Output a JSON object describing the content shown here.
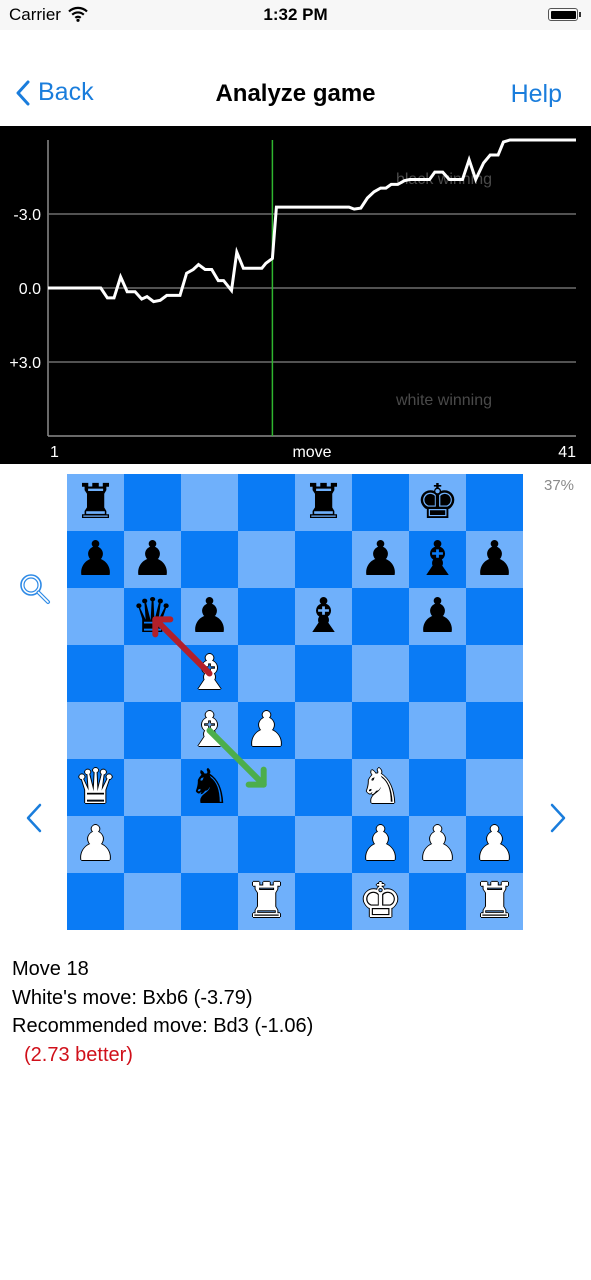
{
  "status_bar": {
    "carrier": "Carrier",
    "time": "1:32 PM",
    "battery_level": 1.0
  },
  "nav": {
    "back_label": "Back",
    "title": "Analyze game",
    "help_label": "Help"
  },
  "chart_data": {
    "type": "line",
    "title": "",
    "xlabel": "move",
    "ylabel": "",
    "x_tick_labels": [
      "1",
      "41"
    ],
    "xlim": [
      1,
      41
    ],
    "ylim": [
      -6.0,
      6.0
    ],
    "y_inverted": true,
    "y_ticks": [
      -3.0,
      0.0,
      3.0
    ],
    "y_tick_labels": [
      "-3.0",
      "0.0",
      "+3.0"
    ],
    "grid": true,
    "annotations": [
      "black winning",
      "white winning"
    ],
    "selected_move": 18,
    "line_color": "#ffffff",
    "marker_color": "#2fb52f",
    "series": [
      {
        "name": "evaluation",
        "points": [
          [
            1.0,
            0.0
          ],
          [
            5.0,
            0.0
          ],
          [
            5.5,
            0.4
          ],
          [
            6.0,
            0.4
          ],
          [
            6.5,
            -0.45
          ],
          [
            7.0,
            0.15
          ],
          [
            7.6,
            0.15
          ],
          [
            8.1,
            0.45
          ],
          [
            8.5,
            0.35
          ],
          [
            9.0,
            0.55
          ],
          [
            9.5,
            0.5
          ],
          [
            10.0,
            0.3
          ],
          [
            11.0,
            0.3
          ],
          [
            11.5,
            -0.6
          ],
          [
            12.0,
            -0.75
          ],
          [
            12.4,
            -0.95
          ],
          [
            12.9,
            -0.75
          ],
          [
            13.4,
            -0.75
          ],
          [
            13.9,
            -0.3
          ],
          [
            14.3,
            -0.3
          ],
          [
            14.9,
            0.1
          ],
          [
            15.3,
            -1.45
          ],
          [
            15.8,
            -0.8
          ],
          [
            16.3,
            -0.8
          ],
          [
            17.2,
            -0.8
          ],
          [
            17.5,
            -1.0
          ],
          [
            18.0,
            -1.2
          ],
          [
            18.3,
            -3.28
          ],
          [
            23.8,
            -3.28
          ],
          [
            24.2,
            -3.2
          ],
          [
            24.7,
            -3.24
          ],
          [
            25.2,
            -3.65
          ],
          [
            25.7,
            -3.9
          ],
          [
            26.2,
            -4.05
          ],
          [
            26.6,
            -4.05
          ],
          [
            27.0,
            -4.2
          ],
          [
            27.5,
            -4.2
          ],
          [
            28.0,
            -4.35
          ],
          [
            28.4,
            -4.4
          ],
          [
            29.3,
            -4.4
          ],
          [
            29.9,
            -4.4
          ],
          [
            30.3,
            -4.7
          ],
          [
            30.9,
            -4.7
          ],
          [
            31.4,
            -4.4
          ],
          [
            32.4,
            -4.4
          ],
          [
            32.9,
            -5.2
          ],
          [
            33.4,
            -4.4
          ],
          [
            34.0,
            -5.07
          ],
          [
            34.5,
            -5.39
          ],
          [
            35.1,
            -5.39
          ],
          [
            35.5,
            -5.92
          ],
          [
            36.0,
            -6.0
          ],
          [
            41.0,
            -6.0
          ]
        ]
      }
    ]
  },
  "board": {
    "zoom_icon": "magnifier-icon",
    "percent": "37%",
    "light_color": "#6fb0fb",
    "dark_color": "#0a7bf5",
    "pieces": [
      {
        "square": "a8",
        "piece": "r"
      },
      {
        "square": "e8",
        "piece": "r"
      },
      {
        "square": "g8",
        "piece": "k"
      },
      {
        "square": "a7",
        "piece": "p"
      },
      {
        "square": "b7",
        "piece": "p"
      },
      {
        "square": "f7",
        "piece": "p"
      },
      {
        "square": "g7",
        "piece": "b"
      },
      {
        "square": "h7",
        "piece": "p"
      },
      {
        "square": "b6",
        "piece": "q"
      },
      {
        "square": "c6",
        "piece": "p"
      },
      {
        "square": "e6",
        "piece": "b"
      },
      {
        "square": "g6",
        "piece": "p"
      },
      {
        "square": "c5",
        "piece": "B"
      },
      {
        "square": "c4",
        "piece": "B"
      },
      {
        "square": "d4",
        "piece": "P"
      },
      {
        "square": "a3",
        "piece": "Q"
      },
      {
        "square": "c3",
        "piece": "n"
      },
      {
        "square": "f3",
        "piece": "N"
      },
      {
        "square": "a2",
        "piece": "P"
      },
      {
        "square": "f2",
        "piece": "P"
      },
      {
        "square": "g2",
        "piece": "P"
      },
      {
        "square": "h2",
        "piece": "P"
      },
      {
        "square": "d1",
        "piece": "R"
      },
      {
        "square": "f1",
        "piece": "K"
      },
      {
        "square": "h1",
        "piece": "R"
      }
    ],
    "arrows": [
      {
        "name": "played-move-arrow",
        "from": "c5",
        "to": "b6",
        "color": "#b3202a"
      },
      {
        "name": "recommended-move-arrow",
        "from": "c4",
        "to": "d3",
        "color": "#4cae4c"
      }
    ]
  },
  "info": {
    "move_label": "Move 18",
    "white_move": "White's move: Bxb6 (-3.79)",
    "recommended_move": "Recommended move: Bd3 (-1.06)",
    "improvement": "(2.73 better)",
    "improvement_color": "#d0101a"
  }
}
